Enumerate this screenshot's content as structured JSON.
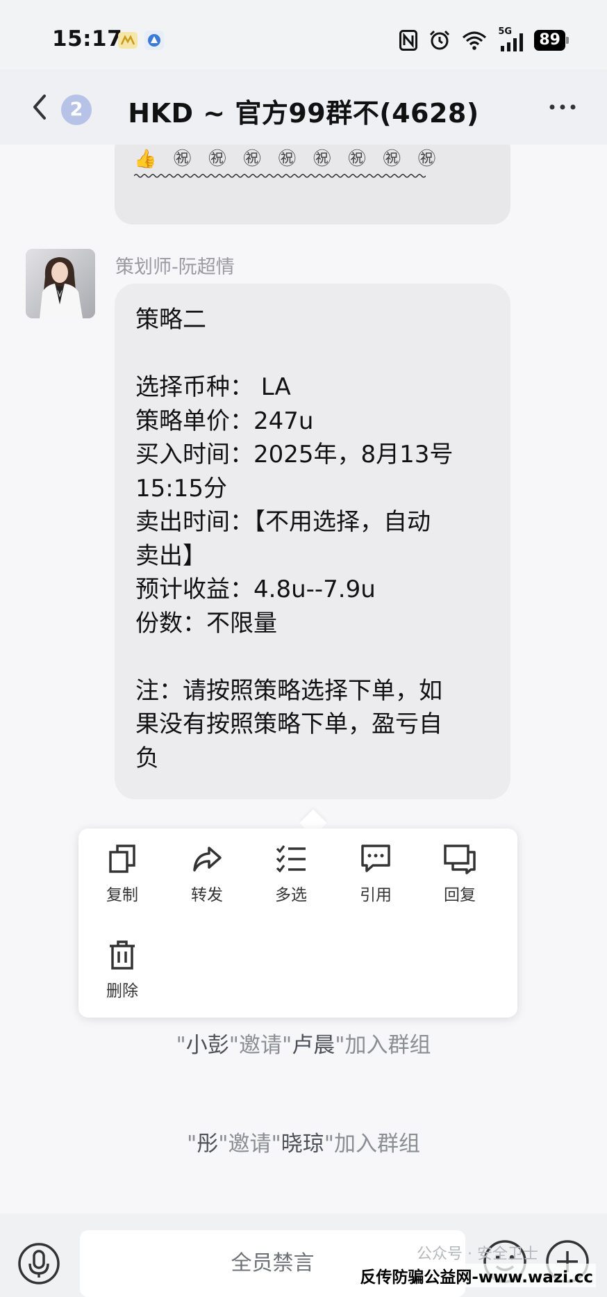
{
  "status_bar": {
    "time": "15:17",
    "network": "5G",
    "battery": "89"
  },
  "header": {
    "unread_count": "2",
    "title": "HKD ~ 官方99群不(4628)"
  },
  "previous_message": {
    "emoji_row": "👍 ㊗ ㊗ ㊗ ㊗ ㊗ ㊗ ㊗ ㊗"
  },
  "message": {
    "sender": "策划师-阮超情",
    "text": "策略二\n\n选择币种： LA\n策略单价：247u\n买入时间：2025年，8月13号\n15:15分\n卖出时间：【不用选择，自动\n卖出】\n预计收益：4.8u--7.9u\n份数：不限量\n\n注：请按照策略选择下单，如\n果没有按照策略下单，盈亏自\n负"
  },
  "context_menu": {
    "items": [
      {
        "label": "复制",
        "icon": "copy-icon"
      },
      {
        "label": "转发",
        "icon": "forward-icon"
      },
      {
        "label": "多选",
        "icon": "multi-select-icon"
      },
      {
        "label": "引用",
        "icon": "quote-icon"
      },
      {
        "label": "回复",
        "icon": "reply-icon"
      },
      {
        "label": "删除",
        "icon": "trash-icon"
      }
    ]
  },
  "system_messages": [
    {
      "inviter": "小彭",
      "verb": "邀请",
      "invitee": "卢晨",
      "suffix": "加入群组"
    },
    {
      "inviter": "彤",
      "verb": "邀请",
      "invitee": "晓琼",
      "suffix": "加入群组"
    }
  ],
  "input_bar": {
    "placeholder": "全员禁言"
  },
  "watermark": {
    "faint": "公众号 · 安全卫士",
    "text": "反传防骗公益网-www.wazi.cc"
  }
}
